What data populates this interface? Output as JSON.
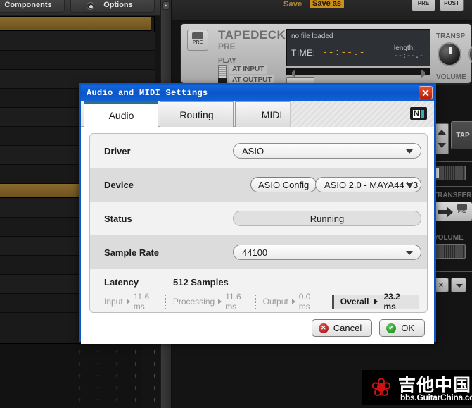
{
  "background": {
    "toolbar": {
      "components_label": "Components",
      "options_label": "Options"
    },
    "daw_top": {
      "save_label": "Save",
      "save_as_label": "Save as",
      "pre_label": "PRE",
      "post_label": "POST"
    },
    "tapedeck": {
      "icon_label": "PRE",
      "title": "TAPEDECK",
      "subtitle": "PRE",
      "play_label": "PLAY",
      "at_input_label": "AT INPUT",
      "at_output_label": "AT OUTPUT",
      "no_file_label": "no file loaded",
      "time_label": "TIME:",
      "time_value": "--:--.-",
      "length_label": "length:",
      "length_value": "--:--.-",
      "transp_label": "TRANSP",
      "volume_label": "VOLUME"
    },
    "right_panel": {
      "tap_label": "TAP",
      "transfer_label": "TRANSFER",
      "transfer_pre_label": "PRE",
      "volume_label": "VOLUME",
      "close_label": "×"
    },
    "watermark": {
      "logo_glyph": "❀",
      "chinese_text": "吉他中国",
      "url_text": "bbs.GuitarChina.com"
    }
  },
  "dialog": {
    "title": "Audio and MIDI Settings",
    "close_label": "✕",
    "tabs": [
      {
        "label": "Audio",
        "active": true
      },
      {
        "label": "Routing",
        "active": false
      },
      {
        "label": "MIDI",
        "active": false
      }
    ],
    "brand_logo": {
      "letter": "N",
      "accent_color": "#3aa7c4"
    },
    "rows": {
      "driver": {
        "label": "Driver",
        "value": "ASIO"
      },
      "device": {
        "label": "Device",
        "config_button": "ASIO Config",
        "value": "ASIO 2.0 - MAYA44 V3"
      },
      "status": {
        "label": "Status",
        "value": "Running"
      },
      "sample_rate": {
        "label": "Sample Rate",
        "value": "44100"
      },
      "latency": {
        "label": "Latency",
        "value": "512 Samples",
        "input_label": "Input",
        "input_value": "11.6 ms",
        "processing_label": "Processing",
        "processing_value": "11.6 ms",
        "output_label": "Output",
        "output_value": "0.0 ms",
        "overall_label": "Overall",
        "overall_value": "23.2 ms"
      }
    },
    "footer": {
      "cancel_label": "Cancel",
      "ok_label": "OK",
      "cancel_icon": "✕",
      "ok_icon": "✔"
    },
    "accent_colors": {
      "titlebar": "#0a56c9",
      "active_tab_accent": "#2d6f85",
      "cancel_icon": "#aa0f0f",
      "ok_icon": "#128a12"
    }
  }
}
